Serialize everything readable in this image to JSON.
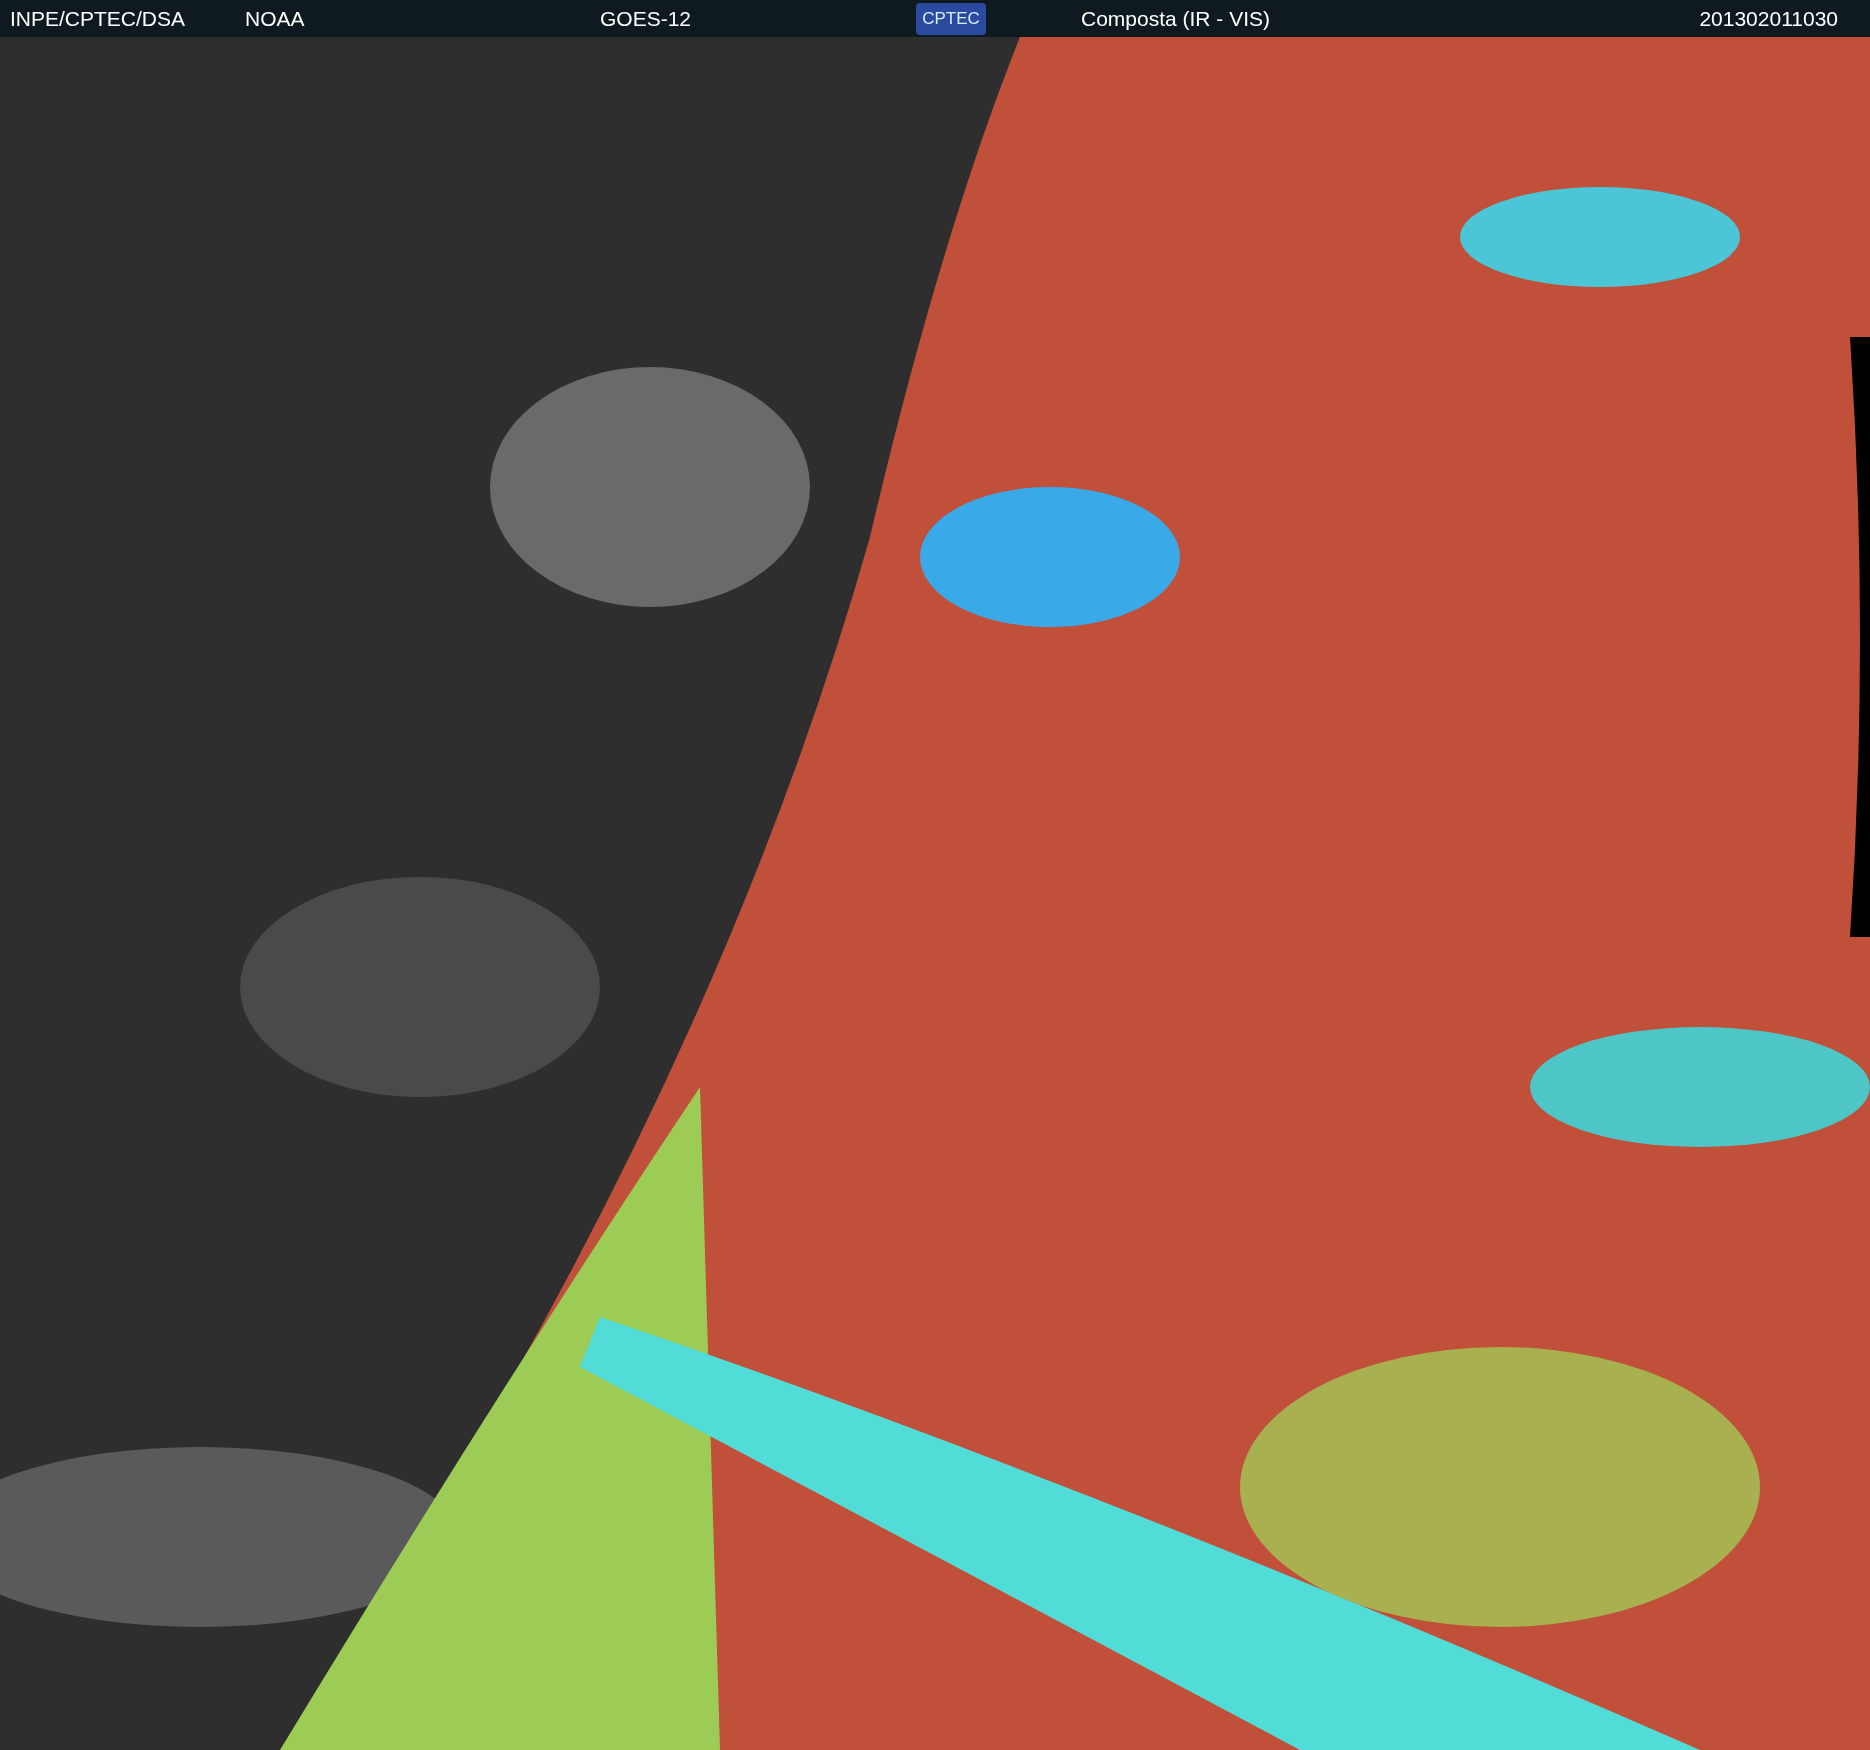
{
  "header": {
    "source": "INPE/CPTEC/DSA",
    "agency": "NOAA",
    "satellite": "GOES-12",
    "logo": "CPTEC",
    "product": "Composta (IR - VIS)",
    "timestamp": "201302011030"
  }
}
